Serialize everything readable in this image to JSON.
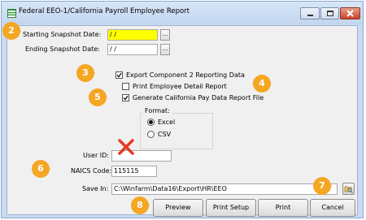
{
  "window": {
    "title": "Federal EEO-1/California Payroll Employee Report",
    "app_icon": "payroll-icon",
    "controls": [
      "minimize-icon",
      "maximize-icon",
      "close-icon"
    ]
  },
  "form": {
    "starting_snapshot_label": "Starting Snapshot Date:",
    "starting_snapshot_value": " / /",
    "ending_snapshot_label": "Ending Snapshot Date:",
    "ending_snapshot_value": " / /",
    "ellipsis": "...",
    "export_component2_label": "Export Component 2 Reporting Data",
    "export_component2_checked": true,
    "print_detail_label": "Print Employee Detail Report",
    "print_detail_checked": false,
    "generate_ca_label": "Generate California Pay Data Report File",
    "generate_ca_checked": true,
    "format_label": "Format:",
    "format_options": [
      "Excel",
      "CSV"
    ],
    "format_selected": "Excel",
    "user_id_label": "User ID:",
    "user_id_value": "",
    "naics_label": "NAICS Code:",
    "naics_value": "115115",
    "save_in_label": "Save In:",
    "save_in_value": "C:\\Winfarm\\Data16\\Export\\HR\\EEO",
    "browse_icon": "folder-browse-icon"
  },
  "buttons": {
    "preview": "Preview",
    "print_setup": "Print Setup",
    "print": "Print",
    "cancel": "Cancel"
  },
  "annotations": {
    "badges": [
      "2",
      "3",
      "4",
      "5",
      "6",
      "7",
      "8"
    ],
    "badge_color": "#f5a623",
    "highlight_color": "#ffff00",
    "x_mark_color": "#e53a23",
    "x_mark_icon": "red-x-icon"
  }
}
